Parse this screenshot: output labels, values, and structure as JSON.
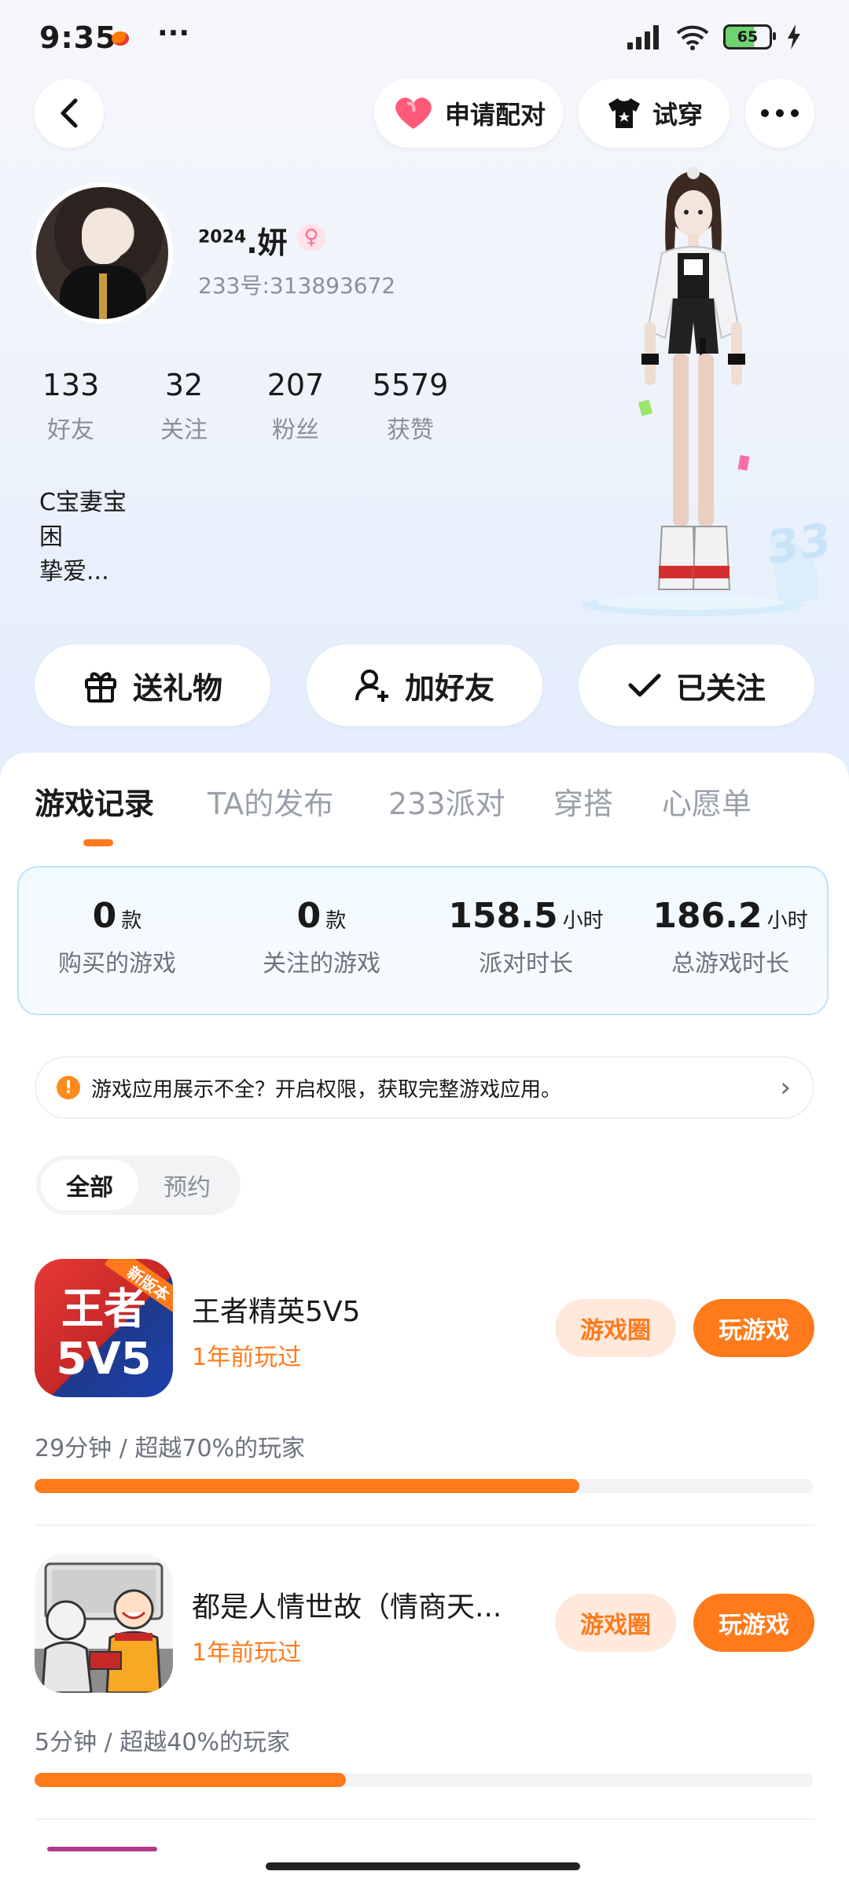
{
  "status_bar": {
    "time": "9:35",
    "dots": "···",
    "battery": "65"
  },
  "top_bar": {
    "pair_label": "申请配对",
    "tryon_label": "试穿"
  },
  "profile": {
    "name_sup": "2024",
    "name": ".妍",
    "gender_symbol": "♀",
    "uid": "233号:313893672",
    "stats": [
      {
        "num": "133",
        "label": "好友"
      },
      {
        "num": "32",
        "label": "关注"
      },
      {
        "num": "207",
        "label": "粉丝"
      },
      {
        "num": "5579",
        "label": "获赞"
      }
    ],
    "bio": "C宝妻宝\n困\n挚爱..."
  },
  "actions": {
    "gift_label": "送礼物",
    "add_friend_label": "加好友",
    "followed_label": "已关注"
  },
  "tabs": [
    "游戏记录",
    "TA的发布",
    "233派对",
    "穿搭",
    "心愿单"
  ],
  "summary": [
    {
      "value": "0",
      "unit": "款",
      "label": "购买的游戏"
    },
    {
      "value": "0",
      "unit": "款",
      "label": "关注的游戏"
    },
    {
      "value": "158.5",
      "unit": "小时",
      "label": "派对时长"
    },
    {
      "value": "186.2",
      "unit": "小时",
      "label": "总游戏时长"
    }
  ],
  "notice": {
    "icon": "!",
    "text": "游戏应用展示不全？开启权限，获取完整游戏应用。"
  },
  "segment": {
    "all": "全部",
    "reserve": "预约"
  },
  "games": [
    {
      "title": "王者精英5V5",
      "played": "1年前玩过",
      "circle_label": "游戏圈",
      "play_label": "玩游戏",
      "stats": "29分钟 / 超越70%的玩家",
      "progress": 0.7,
      "icon_text_top": "王者",
      "icon_text_bottom": "5V5",
      "icon_badge": "新版本"
    },
    {
      "title": "都是人情世故（情商天...",
      "played": "1年前玩过",
      "circle_label": "游戏圈",
      "play_label": "玩游戏",
      "stats": "5分钟 / 超越40%的玩家",
      "progress": 0.4
    }
  ],
  "colors": {
    "accent": "#ff7a1a",
    "accent_light": "#ffe9dc",
    "heart": "#ff5a7a"
  }
}
